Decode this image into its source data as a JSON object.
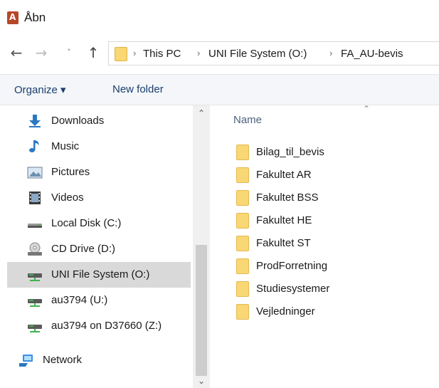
{
  "window": {
    "title": "Åbn",
    "app_icon": "access-icon"
  },
  "navigation": {
    "back_icon": "back-arrow-icon",
    "forward_icon": "forward-arrow-icon",
    "recent_icon": "chevron-down-icon",
    "up_icon": "up-arrow-icon",
    "breadcrumb": [
      "This PC",
      "UNI File System (O:)",
      "FA_AU-bevis"
    ]
  },
  "toolbar": {
    "organize_label": "Organize ▾",
    "new_folder_label": "New folder"
  },
  "sidebar": {
    "items": [
      {
        "label": "Downloads",
        "icon": "downloads-icon"
      },
      {
        "label": "Music",
        "icon": "music-icon"
      },
      {
        "label": "Pictures",
        "icon": "pictures-icon"
      },
      {
        "label": "Videos",
        "icon": "videos-icon"
      },
      {
        "label": "Local Disk (C:)",
        "icon": "local-disk-icon"
      },
      {
        "label": "CD Drive (D:)",
        "icon": "cd-drive-icon"
      },
      {
        "label": "UNI File System (O:)",
        "icon": "network-drive-icon",
        "selected": true
      },
      {
        "label": "au3794 (U:)",
        "icon": "network-drive-icon"
      },
      {
        "label": "au3794 on D37660 (Z:)",
        "icon": "network-drive-icon"
      },
      {
        "label": "Network",
        "icon": "network-icon"
      }
    ]
  },
  "content": {
    "column_header": "Name",
    "files": [
      "Bilag_til_bevis",
      "Fakultet AR",
      "Fakultet BSS",
      "Fakultet HE",
      "Fakultet ST",
      "ProdForretning",
      "Studiesystemer",
      "Vejledninger"
    ]
  },
  "colors": {
    "folder": "#f8d774",
    "selected_bg": "#d9d9d9",
    "toolbar_bg": "#f4f6f9",
    "link_text": "#1a3e6e"
  }
}
